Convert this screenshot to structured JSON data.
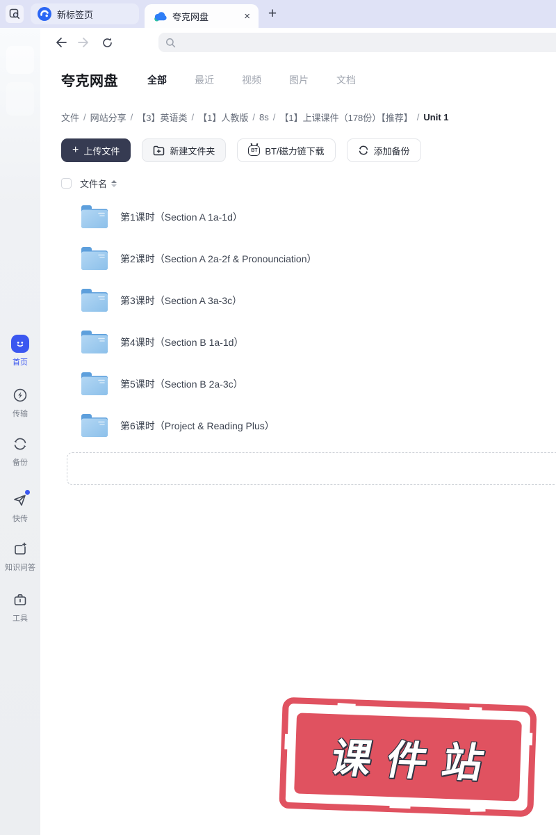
{
  "browser": {
    "tabs": [
      {
        "label": "新标签页",
        "active": false
      },
      {
        "label": "夸克网盘",
        "active": true
      }
    ],
    "close_tab_glyph": "×",
    "new_tab_glyph": "+",
    "search_value": ""
  },
  "sidebar": {
    "items": [
      {
        "label": "首页",
        "active": true
      },
      {
        "label": "传输",
        "active": false
      },
      {
        "label": "备份",
        "active": false
      },
      {
        "label": "快传",
        "active": false,
        "badge": true
      },
      {
        "label": "知识问答",
        "active": false
      },
      {
        "label": "工具",
        "active": false
      }
    ]
  },
  "header": {
    "title": "夸克网盘",
    "filter_tabs": [
      {
        "label": "全部",
        "active": true
      },
      {
        "label": "最近",
        "active": false
      },
      {
        "label": "视频",
        "active": false
      },
      {
        "label": "图片",
        "active": false
      },
      {
        "label": "文档",
        "active": false
      }
    ]
  },
  "breadcrumb": {
    "separator": "/",
    "items": [
      "文件",
      "网站分享",
      "【3】英语类",
      "【1】人教版",
      "8s",
      "【1】上课课件（178份）【推荐】",
      "Unit 1"
    ]
  },
  "actions": {
    "upload": "上传文件",
    "upload_plus": "+",
    "new_folder": "新建文件夹",
    "bt_download": "BT/磁力链下载",
    "bt_glyph": "BT",
    "add_backup": "添加备份"
  },
  "file_table": {
    "name_header": "文件名",
    "rows": [
      {
        "name": "第1课时（Section A 1a-1d）",
        "type": "folder"
      },
      {
        "name": "第2课时（Section A 2a-2f & Pronounciation）",
        "type": "folder"
      },
      {
        "name": "第3课时（Section A 3a-3c）",
        "type": "folder"
      },
      {
        "name": "第4课时（Section B 1a-1d）",
        "type": "folder"
      },
      {
        "name": "第5课时（Section B 2a-3c）",
        "type": "folder"
      },
      {
        "name": "第6课时（Project & Reading Plus）",
        "type": "folder"
      }
    ]
  },
  "stamp": {
    "text": "课件站",
    "color": "#e05260"
  },
  "colors": {
    "tabbar_bg": "#dfe2f6",
    "accent_blue": "#3b57f0",
    "primary_button_bg": "#363b52",
    "folder_blue_back": "#5d9fdc",
    "folder_blue_front": "#9cc9ef",
    "stamp_red": "#e05260"
  }
}
